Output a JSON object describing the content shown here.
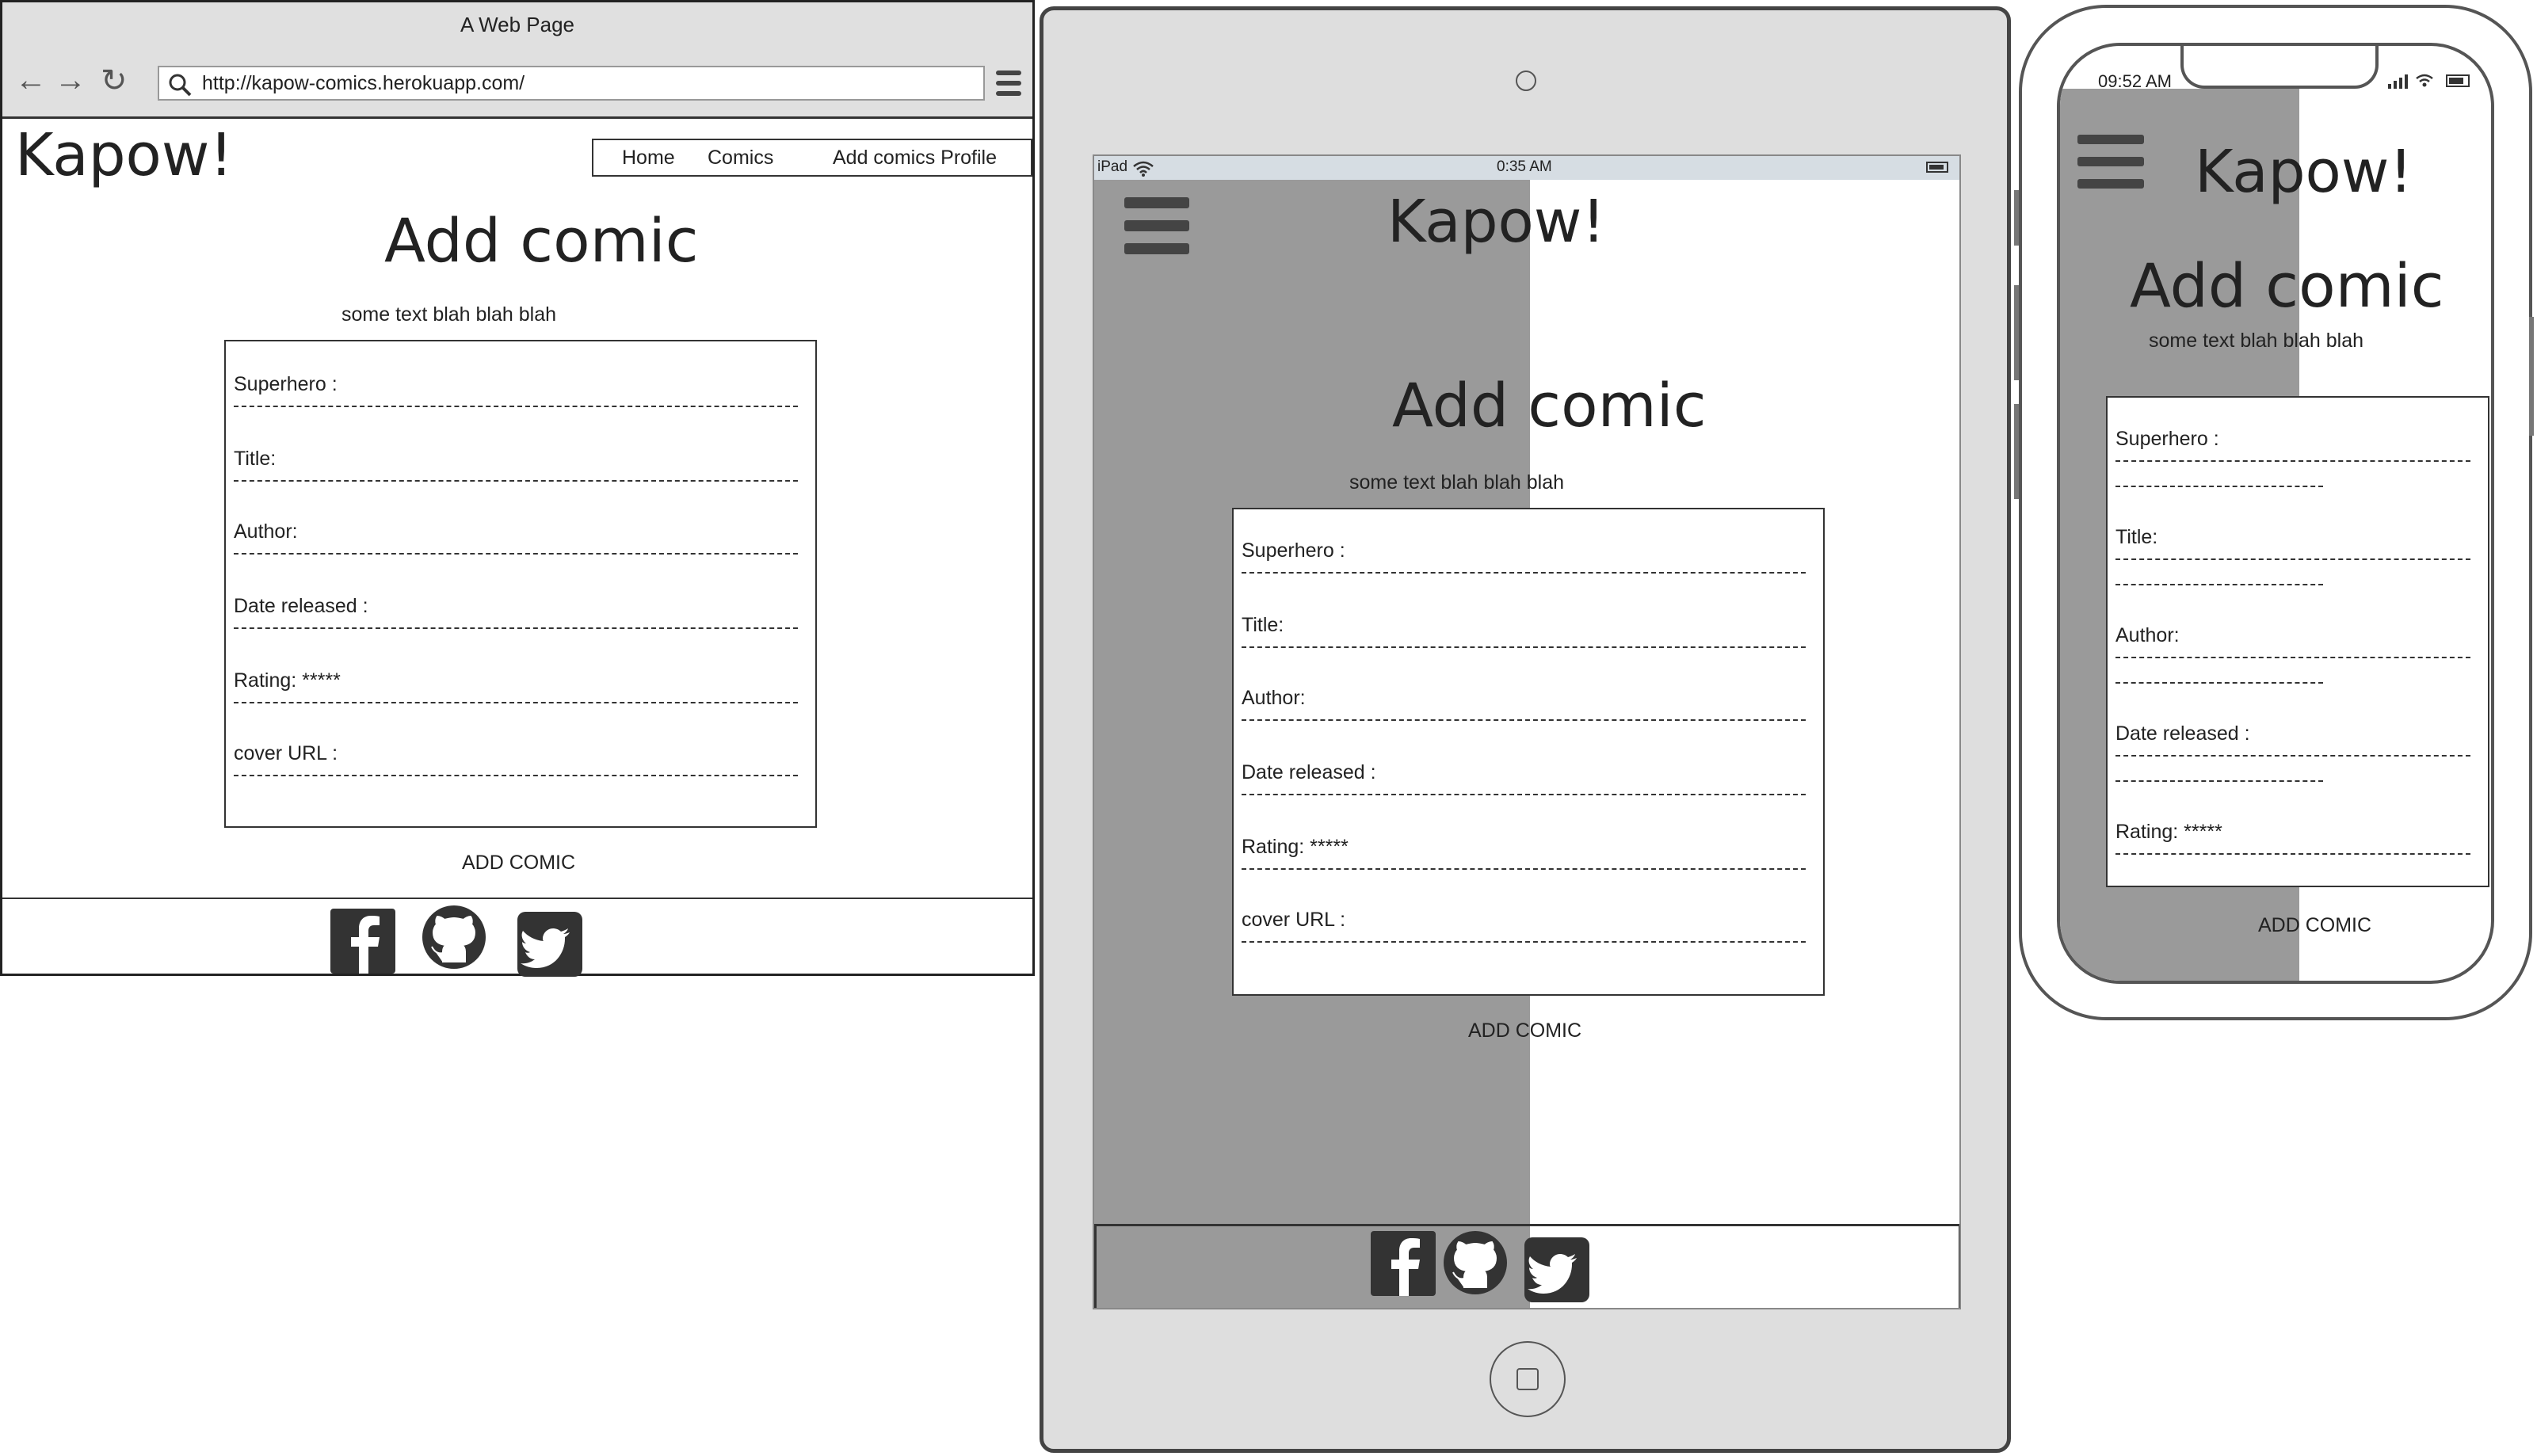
{
  "browser": {
    "window_title": "A Web Page",
    "url": "http://kapow-comics.herokuapp.com/"
  },
  "site": {
    "logo": "Kapow!",
    "nav": {
      "home": "Home",
      "comics": "Comics",
      "add_comics_profile": "Add comics Profile"
    },
    "heading": "Add comic",
    "subtext": "some text blah blah blah",
    "fields": {
      "superhero": "Superhero :",
      "title": "Title:",
      "author": "Author:",
      "date_released": "Date released :",
      "rating": "Rating: *****",
      "cover_url": "cover  URL :"
    },
    "submit": "ADD COMIC",
    "social_icons": [
      "facebook-icon",
      "github-icon",
      "twitter-icon"
    ]
  },
  "ipad": {
    "device_label": "iPad",
    "time": "0:35 AM"
  },
  "iphone": {
    "time": "09:52 AM"
  },
  "colors": {
    "panel_gray": "#9a9a9a",
    "device_gray": "#dedede",
    "ink": "#222222"
  }
}
